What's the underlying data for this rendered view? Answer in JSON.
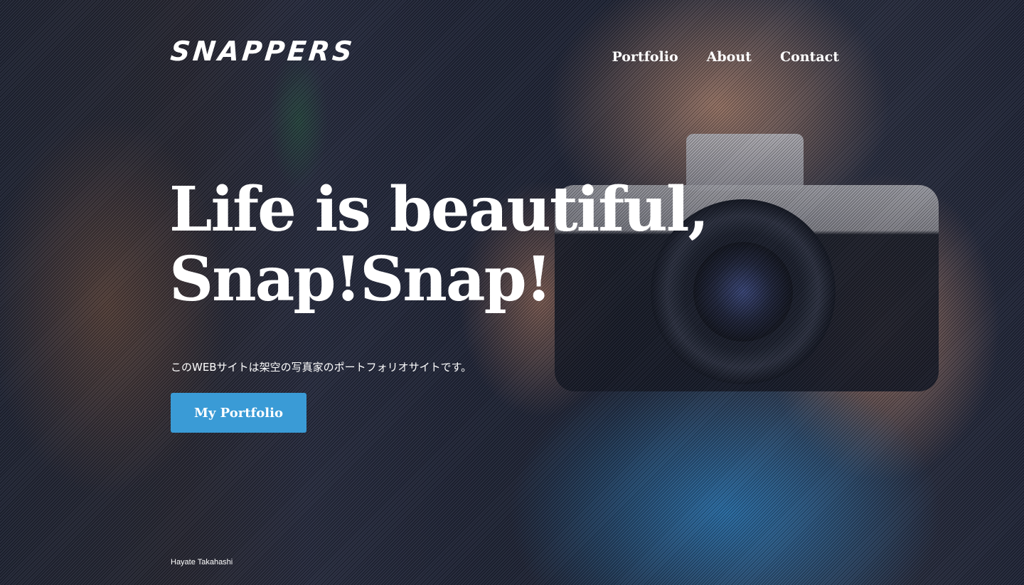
{
  "site": {
    "logo_text": "SNAPPERS"
  },
  "nav": {
    "items": [
      {
        "label": "Portfolio"
      },
      {
        "label": "About"
      },
      {
        "label": "Contact"
      }
    ]
  },
  "hero": {
    "headline_line1": "Life is beautiful,",
    "headline_line2": "Snap!Snap!",
    "tagline": "このWEBサイトは架空の写真家のポートフォリオサイトです。",
    "cta_label": "My Portfolio",
    "cta_color": "#3a9bd6"
  },
  "footer": {
    "credit": "Hayate Takahashi"
  }
}
